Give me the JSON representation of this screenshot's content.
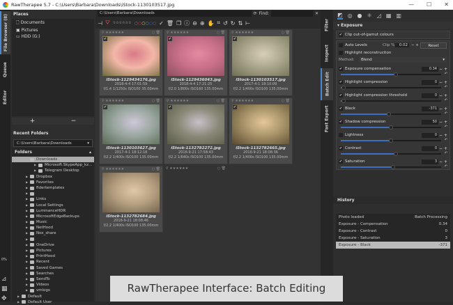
{
  "window": {
    "title": "RawTherapee 5.7 - C:\\Users\\Barbara\\Downloads\\iStock-1130103517.jpg",
    "minimize": "—",
    "maximize": "☐",
    "close": "✕"
  },
  "left_tabs": [
    "File Browser (8)",
    "Queue",
    "Editor"
  ],
  "places": {
    "title": "Places",
    "items": [
      "Documents",
      "Pictures",
      "HDD (G:)"
    ],
    "add": "+",
    "remove": "−"
  },
  "recent": {
    "title": "Recent Folders",
    "value": "C:\\Users\\Barbara\\Downloads"
  },
  "folders": {
    "title": "Folders",
    "items": [
      {
        "name": "Downloads",
        "level": 2,
        "selected": true,
        "expanded": true
      },
      {
        "name": "Microsoft.SkypeApp_kz...",
        "level": 3
      },
      {
        "name": "Telegram Desktop",
        "level": 3
      },
      {
        "name": "Dropbox",
        "level": 2
      },
      {
        "name": "Favorites",
        "level": 2
      },
      {
        "name": "fldertemplates",
        "level": 2
      },
      {
        "name": "",
        "level": 2
      },
      {
        "name": "Links",
        "level": 2
      },
      {
        "name": "Local Settings",
        "level": 2
      },
      {
        "name": "LuminanceHDR",
        "level": 2
      },
      {
        "name": "MicrosoftEdgeBackups",
        "level": 2
      },
      {
        "name": "Music",
        "level": 2
      },
      {
        "name": "NetHood",
        "level": 2
      },
      {
        "name": "Nox_share",
        "level": 2
      },
      {
        "name": "",
        "level": 2
      },
      {
        "name": "OneDrive",
        "level": 2
      },
      {
        "name": "Pictures",
        "level": 2
      },
      {
        "name": "PrintHood",
        "level": 2
      },
      {
        "name": "Recent",
        "level": 2
      },
      {
        "name": "Saved Games",
        "level": 2
      },
      {
        "name": "Searches",
        "level": 2
      },
      {
        "name": "SendTo",
        "level": 2
      },
      {
        "name": "Videos",
        "level": 2
      },
      {
        "name": "vmlogs",
        "level": 2
      },
      {
        "name": "Default",
        "level": 1
      },
      {
        "name": "Default User",
        "level": 1
      }
    ]
  },
  "zoom_percent": "0%",
  "browser": {
    "path": "C:\\Users\\Barbara\\Downloads",
    "find_label": "Find:",
    "find_value": "",
    "clear": "✕"
  },
  "thumbnails": [
    {
      "name": "iStock-1129434176.jpg",
      "date": "2018-4-4 17:01:59",
      "exif": "f/1.4 1/1250s ISO100 35.00mm",
      "colors": [
        "#d87a86",
        "#f3b7a8",
        "#6b6a3a"
      ]
    },
    {
      "name": "iStock-1129436043.jpg",
      "date": "2018-4-4 17:21:25",
      "exif": "f/2.0 1/800s ISO160 135.00mm",
      "colors": [
        "#e48aa0",
        "#c9708a",
        "#8d5060"
      ]
    },
    {
      "name": "iStock-1130103517.jpg",
      "date": "2017-4-1 18:10:09",
      "exif": "f/2.2 1/400s ISO100 135.00mm",
      "colors": [
        "#d8d0b8",
        "#a9a58a",
        "#6f6e55"
      ]
    },
    {
      "name": "iStock-1130103627.jpg",
      "date": "2017-4-1 18:12:18",
      "exif": "f/2.2 1/400s ISO100 135.00mm",
      "colors": [
        "#cfc8d8",
        "#9aa6a0",
        "#5a6a55"
      ]
    },
    {
      "name": "iStock-1132782272.jpg",
      "date": "2016-9-21 17:58:43",
      "exif": "f/2.2 1/640s ISO100 135.00mm",
      "colors": [
        "#c8c0c8",
        "#8b8a7a",
        "#5a5a48"
      ]
    },
    {
      "name": "iStock-1132782665.jpg",
      "date": "2016-9-21 18:08:36",
      "exif": "f/2.2 1/400s ISO100 135.00mm",
      "colors": [
        "#e6c89a",
        "#a8946a",
        "#5a4a30"
      ]
    },
    {
      "name": "iStock-1132782684.jpg",
      "date": "2016-9-21 18:08:46",
      "exif": "f/2.2 1/400s ISO100 135.00mm",
      "colors": [
        "#e0c8a8",
        "#b4a080",
        "#6a5a48"
      ]
    }
  ],
  "right_tabs": [
    "Filter",
    "Inspect",
    "Batch Edit",
    "Fast Export"
  ],
  "exposure": {
    "title": "Exposure",
    "clip_label": "Clip out-of-gamut colours",
    "clip_checked": true,
    "auto_levels": "Auto Levels",
    "clip_pct_label": "Clip %",
    "clip_pct": "0.02",
    "reset": "Reset",
    "highlight_recon": "Highlight reconstruction",
    "method_label": "Method:",
    "method": "Blend",
    "sliders": [
      {
        "label": "Exposure compensation",
        "value": "0.34",
        "checked": true,
        "pos": 0.55
      },
      {
        "label": "Highlight compression",
        "value": "0",
        "checked": true,
        "pos": 0.03
      },
      {
        "label": "Highlight compression threshold",
        "value": "0",
        "checked": true,
        "pos": 0.03
      },
      {
        "label": "Black",
        "value": "-371",
        "checked": true,
        "pos": 0.48
      },
      {
        "label": "Shadow compression",
        "value": "50",
        "checked": true,
        "pos": 0.5
      },
      {
        "label": "Lightness",
        "value": "0",
        "checked": false,
        "pos": 0.5
      },
      {
        "label": "Contrast",
        "value": "0",
        "checked": true,
        "pos": 0.55
      },
      {
        "label": "Saturation",
        "value": "3",
        "checked": true,
        "pos": 0.52
      }
    ]
  },
  "history": {
    "title": "History",
    "rows": [
      {
        "label": "Photo loaded",
        "value": "Batch Processing"
      },
      {
        "label": "Exposure - Compensation",
        "value": "0.34"
      },
      {
        "label": "Exposure - Contrast",
        "value": "0"
      },
      {
        "label": "Exposure - Saturation",
        "value": "3"
      },
      {
        "label": "Exposure - Black",
        "value": "-371",
        "selected": true
      }
    ]
  },
  "caption": "RawTherapee Interface: Batch Editing"
}
